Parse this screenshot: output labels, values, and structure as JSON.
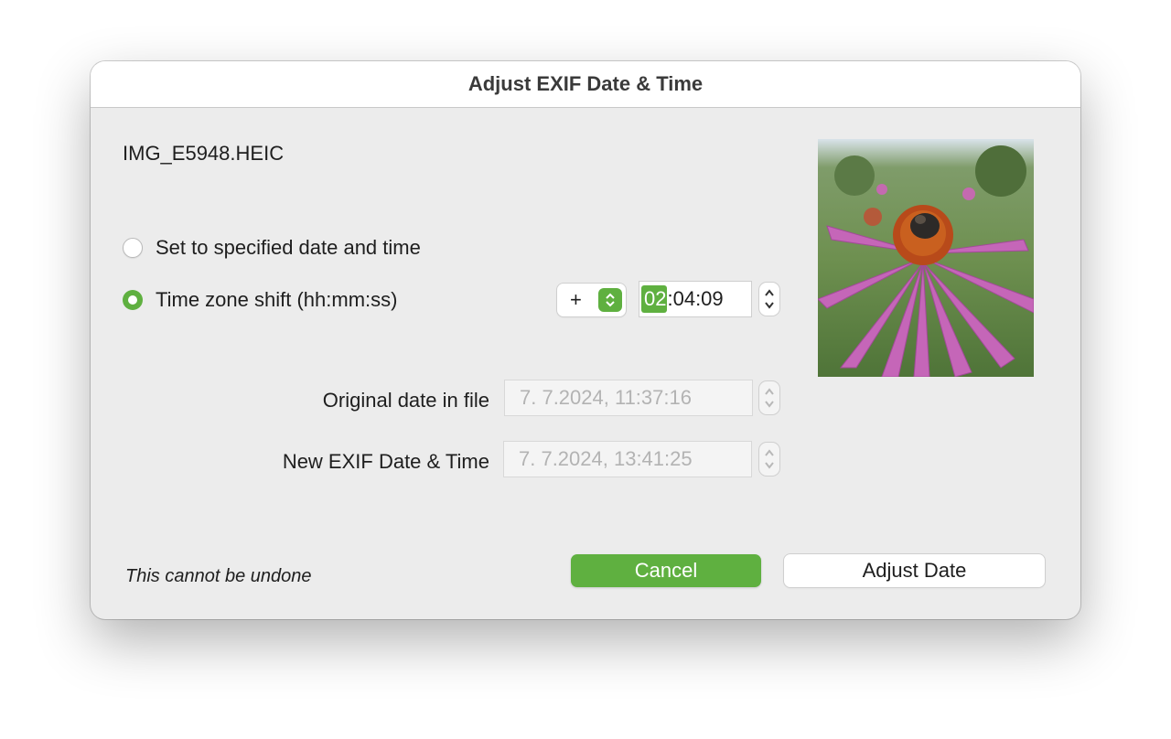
{
  "dialog": {
    "title": "Adjust EXIF Date & Time",
    "filename": "IMG_E5948.HEIC"
  },
  "options": {
    "specified": {
      "label": "Set to specified date and time",
      "selected": false
    },
    "shift": {
      "label": "Time zone shift  (hh:mm:ss)",
      "selected": true
    }
  },
  "shift": {
    "sign": "+",
    "hours": "02",
    "rest": ":04:09"
  },
  "fields": {
    "original_label": "Original date in file",
    "original_value": "7.  7.2024, 11:37:16",
    "new_label": "New EXIF Date & Time",
    "new_value": "7.  7.2024, 13:41:25"
  },
  "footer": {
    "warning": "This cannot be undone",
    "cancel_label": "Cancel",
    "adjust_label": "Adjust Date"
  },
  "colors": {
    "accent": "#5fb040"
  }
}
